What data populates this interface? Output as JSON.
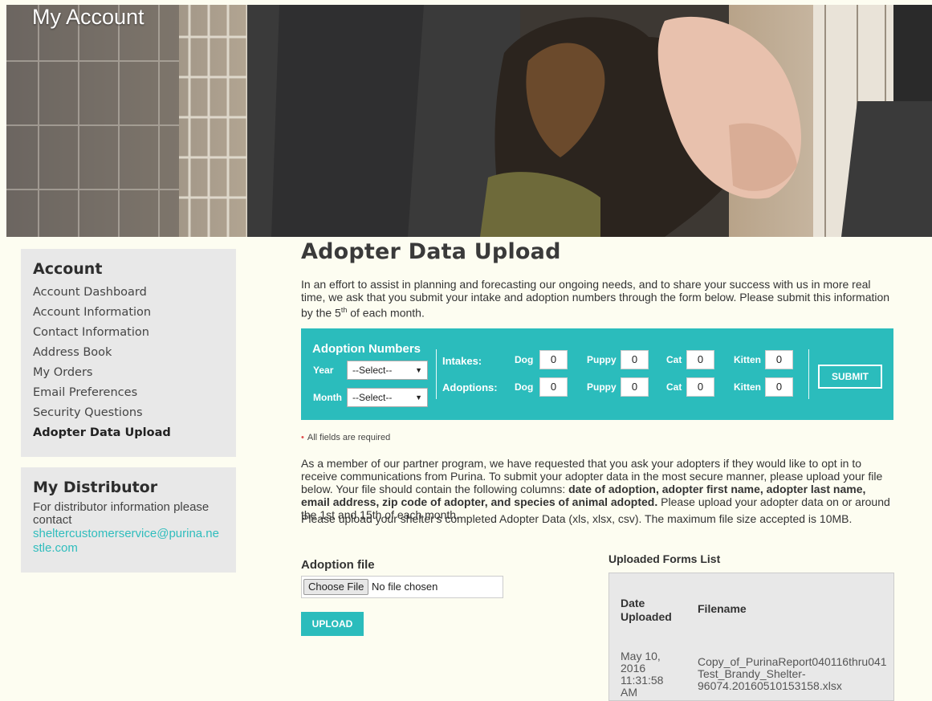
{
  "hero": {
    "title": "My Account"
  },
  "sidebar": {
    "account_heading": "Account",
    "items": [
      {
        "label": "Account Dashboard"
      },
      {
        "label": "Account Information"
      },
      {
        "label": "Contact Information"
      },
      {
        "label": "Address Book"
      },
      {
        "label": "My Orders"
      },
      {
        "label": "Email Preferences"
      },
      {
        "label": "Security Questions"
      },
      {
        "label": "Adopter Data Upload",
        "active": true
      }
    ],
    "distributor_heading": "My Distributor",
    "distributor_text": "For distributor information please contact",
    "distributor_email": "sheltercustomerservice@purina.nestle.com"
  },
  "main": {
    "title": "Adopter Data Upload",
    "intro_text": "In an effort to assist in planning and forecasting our ongoing needs, and to share your success with us in more real time, we ask that you submit your intake and adoption numbers through the form below. Please submit this information by the 5",
    "intro_sup": "th",
    "intro_tail": " of each month.",
    "form": {
      "title": "Adoption Numbers",
      "year_label": "Year",
      "year_value": "--Select--",
      "month_label": "Month",
      "month_value": "--Select--",
      "intakes_label": "Intakes:",
      "adoptions_label": "Adoptions:",
      "dog_label": "Dog",
      "puppy_label": "Puppy",
      "cat_label": "Cat",
      "kitten_label": "Kitten",
      "intakes": {
        "dog": "0",
        "puppy": "0",
        "cat": "0",
        "kitten": "0"
      },
      "adoptions": {
        "dog": "0",
        "puppy": "0",
        "cat": "0",
        "kitten": "0"
      },
      "submit_label": "SUBMIT"
    },
    "required_note": "All fields are required",
    "member_text_1": "As a member of our partner program, we have requested that you ask your adopters if they would like to opt in to receive communications from Purina. To submit your adopter data in the most secure manner, please upload your file below. Your file should contain the following columns: ",
    "member_text_bold": "date of adoption, adopter first name, adopter last name, email address, zip code of adopter, and species of animal adopted.",
    "member_text_2": " Please upload your adopter data on or around the 1st and 15th of each month.",
    "upload_text": "Please upload your shelter's completed Adopter Data (xls, xlsx, csv). The maximum file size accepted is 10MB.",
    "file_heading": "Adoption file",
    "choose_file_label": "Choose File",
    "no_file_text": "No file chosen",
    "upload_label": "UPLOAD",
    "list_heading": "Uploaded Forms List",
    "list_columns": [
      "Date Uploaded",
      "Filename"
    ],
    "list_rows": [
      {
        "date": "May 10, 2016 11:31:58 AM",
        "filename": "Copy_of_PurinaReport040116thru041 Test_Brandy_Shelter-96074.20160510153158.xlsx"
      }
    ]
  },
  "colors": {
    "accent": "#2bbcbc",
    "background": "#fdfdf1",
    "sidebar": "#e8e8e8"
  }
}
